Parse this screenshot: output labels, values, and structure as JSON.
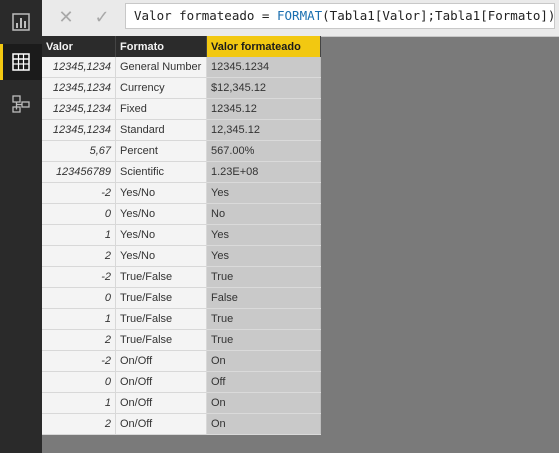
{
  "formula_bar": {
    "cancel_icon": "close-icon",
    "commit_icon": "check-icon",
    "formula_prefix": "Valor formateado = ",
    "formula_function": "FORMAT",
    "formula_args": "(Tabla1[Valor];Tabla1[Formato])"
  },
  "sidebar": {
    "items": [
      {
        "name": "report-view",
        "icon": "bar-chart-icon"
      },
      {
        "name": "data-view",
        "icon": "table-icon",
        "active": true
      },
      {
        "name": "model-view",
        "icon": "relationship-icon"
      }
    ]
  },
  "table": {
    "columns": [
      "Valor",
      "Formato",
      "Valor formateado"
    ],
    "rows": [
      [
        "12345,1234",
        "General Number",
        "12345.1234"
      ],
      [
        "12345,1234",
        "Currency",
        "$12,345.12"
      ],
      [
        "12345,1234",
        "Fixed",
        "12345.12"
      ],
      [
        "12345,1234",
        "Standard",
        "12,345.12"
      ],
      [
        "5,67",
        "Percent",
        "567.00%"
      ],
      [
        "123456789",
        "Scientific",
        "1.23E+08"
      ],
      [
        "-2",
        "Yes/No",
        "Yes"
      ],
      [
        "0",
        "Yes/No",
        "No"
      ],
      [
        "1",
        "Yes/No",
        "Yes"
      ],
      [
        "2",
        "Yes/No",
        "Yes"
      ],
      [
        "-2",
        "True/False",
        "True"
      ],
      [
        "0",
        "True/False",
        "False"
      ],
      [
        "1",
        "True/False",
        "True"
      ],
      [
        "2",
        "True/False",
        "True"
      ],
      [
        "-2",
        "On/Off",
        "On"
      ],
      [
        "0",
        "On/Off",
        "Off"
      ],
      [
        "1",
        "On/Off",
        "On"
      ],
      [
        "2",
        "On/Off",
        "On"
      ]
    ]
  },
  "colors": {
    "accent": "#f2c811",
    "header_bg": "#2b2b2b",
    "selected_col_bg": "#c9c9c9",
    "workspace_bg": "#7a7a7a"
  }
}
